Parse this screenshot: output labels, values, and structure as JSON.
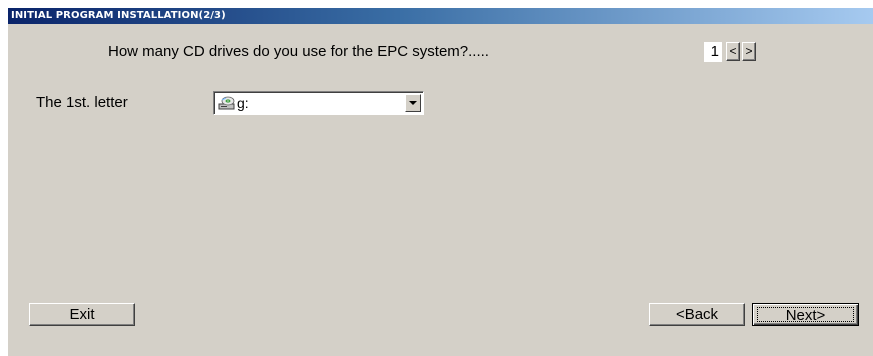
{
  "window": {
    "title": "INITIAL PROGRAM INSTALLATION(2/3)"
  },
  "question": {
    "text": "How many CD drives do you use for the EPC system?.....",
    "count": "1",
    "prev_label": "<",
    "next_label": ">"
  },
  "drive": {
    "label": "The 1st. letter",
    "selected": "g:",
    "icon": "cd-drive-icon"
  },
  "buttons": {
    "exit": "Exit",
    "back": "<Back",
    "next": "Next>"
  },
  "colors": {
    "face": "#d4d0c8",
    "title_start": "#0a246a",
    "title_end": "#a6caf0"
  }
}
